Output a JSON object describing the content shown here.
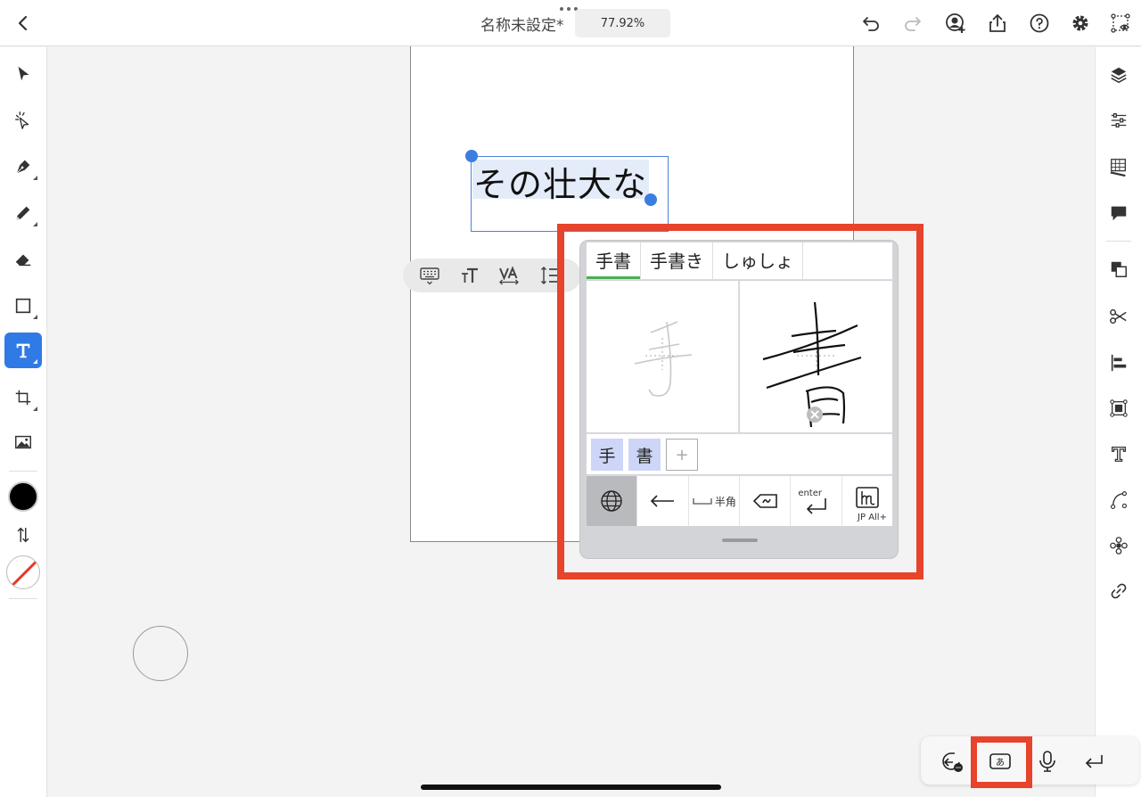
{
  "toolbar": {
    "document_title": "名称未設定*",
    "zoom": "77.92%"
  },
  "canvas": {
    "text_content": "その壮大な"
  },
  "handwriting": {
    "candidates": [
      {
        "label": "手書",
        "selected": true
      },
      {
        "label": "手書き",
        "selected": false
      },
      {
        "label": "しゅしょ",
        "selected": false
      }
    ],
    "recognized_chars": [
      "手",
      "書"
    ],
    "add_label": "+",
    "keys": {
      "space_label": "半角",
      "enter_label": "enter",
      "keyboard_label": "JP All+"
    }
  },
  "colors": {
    "accent": "#2f7ae5",
    "highlight_frame": "#e8432b",
    "fill_color": "#000000",
    "stroke_none_slash": "#e53a2a"
  }
}
